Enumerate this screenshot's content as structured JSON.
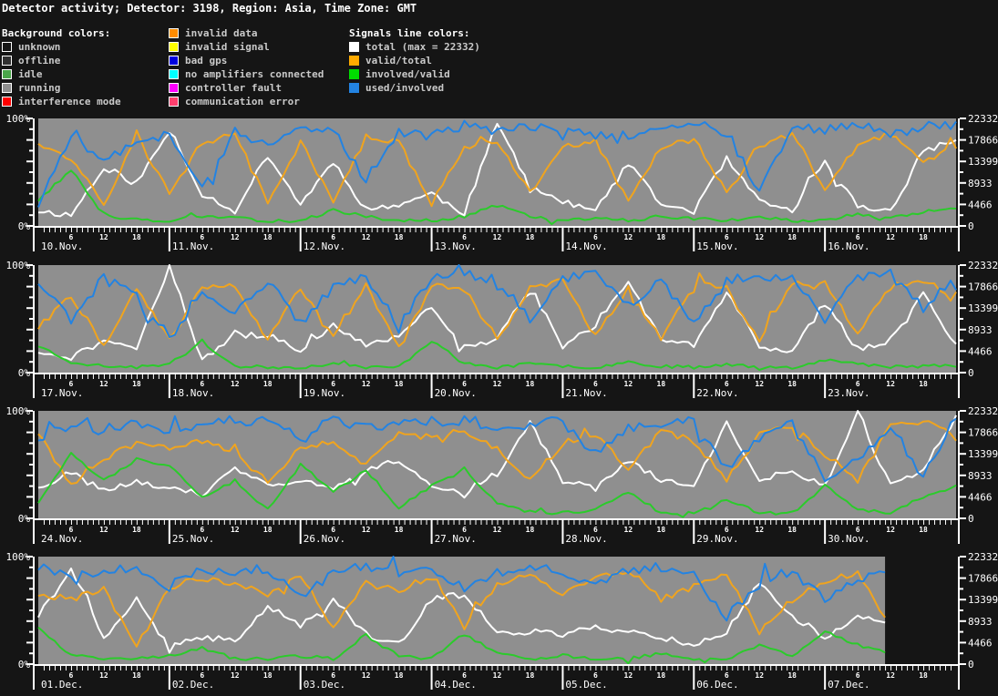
{
  "title": "Detector activity; Detector: 3198, Region: Asia, Time Zone: GMT",
  "colors": {
    "page_bg": "#151515",
    "plot_bg": "#8f8f8f",
    "axis": "#ffffff",
    "legend_text": "#c9c9c9",
    "header_text": "#ffffff"
  },
  "legend": {
    "background_header": "Background colors:",
    "background_items": [
      {
        "label": "unknown",
        "color": "#151515"
      },
      {
        "label": "offline",
        "color": "#303030"
      },
      {
        "label": "idle",
        "color": "#4aa64a"
      },
      {
        "label": "running",
        "color": "#8f8f8f"
      },
      {
        "label": "interference mode",
        "color": "#ff0000"
      }
    ],
    "status_items": [
      {
        "label": "invalid data",
        "color": "#ff8c00"
      },
      {
        "label": "invalid signal",
        "color": "#ffff00"
      },
      {
        "label": "bad gps",
        "color": "#0000dd"
      },
      {
        "label": "no amplifiers connected",
        "color": "#00ffff"
      },
      {
        "label": "controller fault",
        "color": "#ff00ff"
      },
      {
        "label": "communication error",
        "color": "#ff3f6e"
      }
    ],
    "signals_header": "Signals line colors:",
    "signal_items": [
      {
        "label": "total (max = 22332)",
        "color": "#ffffff"
      },
      {
        "label": "valid/total",
        "color": "#ffaa00"
      },
      {
        "label": "involved/valid",
        "color": "#00dd00"
      },
      {
        "label": "used/involved",
        "color": "#2383e2"
      }
    ]
  },
  "axes": {
    "left_top": "100%",
    "left_bottom": "0%",
    "right_labels": [
      "22332",
      "17866",
      "13399",
      "8933",
      "4466",
      "0"
    ],
    "right_max": 22332,
    "hour_labels": [
      "6",
      "12",
      "18"
    ]
  },
  "chart_data": [
    {
      "type": "line",
      "dates": [
        "10.Nov.",
        "11.Nov.",
        "12.Nov.",
        "13.Nov.",
        "14.Nov.",
        "15.Nov.",
        "16.Nov."
      ],
      "days": 7,
      "end_hour": 168,
      "ylim_left": [
        0,
        100
      ],
      "ylim_right": [
        0,
        22332
      ],
      "background_state": "running",
      "series": [
        {
          "name": "total",
          "color": "#ffffff",
          "jitter": 3,
          "seed": 11,
          "values6h": [
            14,
            10,
            55,
            40,
            88,
            30,
            14,
            66,
            20,
            60,
            15,
            20,
            30,
            12,
            95,
            38,
            22,
            14,
            58,
            20,
            14,
            62,
            22,
            14,
            60,
            18,
            14,
            70,
            80
          ]
        },
        {
          "name": "valid/total",
          "color": "#f0a41e",
          "jitter": 3,
          "seed": 12,
          "values6h": [
            78,
            62,
            20,
            82,
            30,
            78,
            85,
            22,
            78,
            22,
            83,
            78,
            20,
            73,
            80,
            30,
            73,
            80,
            22,
            73,
            82,
            30,
            73,
            85,
            32,
            78,
            85,
            60,
            74
          ]
        },
        {
          "name": "involved/valid",
          "color": "#2bcb2b",
          "jitter": 1.5,
          "seed": 13,
          "values6h": [
            24,
            52,
            10,
            6,
            5,
            9,
            7,
            5,
            5,
            14,
            9,
            5,
            5,
            9,
            19,
            9,
            5,
            7,
            5,
            9,
            7,
            5,
            9,
            5,
            5,
            11,
            7,
            13,
            17
          ]
        },
        {
          "name": "used/involved",
          "color": "#2383e2",
          "jitter": 5,
          "seed": 14,
          "values6h": [
            20,
            85,
            62,
            76,
            86,
            35,
            88,
            74,
            94,
            88,
            42,
            88,
            84,
            94,
            88,
            94,
            88,
            84,
            80,
            88,
            94,
            88,
            32,
            93,
            88,
            94,
            84,
            94,
            94
          ]
        }
      ]
    },
    {
      "type": "line",
      "dates": [
        "17.Nov.",
        "18.Nov.",
        "19.Nov.",
        "20.Nov.",
        "21.Nov.",
        "22.Nov.",
        "23.Nov."
      ],
      "days": 7,
      "end_hour": 168,
      "ylim_left": [
        0,
        100
      ],
      "ylim_right": [
        0,
        22332
      ],
      "background_state": "running",
      "series": [
        {
          "name": "total",
          "color": "#ffffff",
          "jitter": 3,
          "seed": 21,
          "values6h": [
            20,
            14,
            30,
            22,
            100,
            12,
            35,
            35,
            20,
            45,
            25,
            35,
            60,
            25,
            30,
            80,
            25,
            45,
            85,
            30,
            25,
            75,
            25,
            20,
            65,
            22,
            30,
            72,
            25
          ]
        },
        {
          "name": "valid/total",
          "color": "#f0a41e",
          "jitter": 3,
          "seed": 22,
          "values6h": [
            42,
            72,
            25,
            78,
            30,
            80,
            82,
            30,
            78,
            35,
            80,
            25,
            80,
            78,
            30,
            80,
            85,
            35,
            80,
            30,
            82,
            78,
            30,
            82,
            85,
            35,
            80,
            85,
            72
          ]
        },
        {
          "name": "involved/valid",
          "color": "#2bcb2b",
          "jitter": 1.5,
          "seed": 23,
          "values6h": [
            25,
            10,
            6,
            5,
            8,
            28,
            6,
            5,
            5,
            8,
            5,
            5,
            30,
            8,
            5,
            8,
            6,
            5,
            10,
            6,
            5,
            8,
            5,
            5,
            12,
            8,
            5,
            8,
            6
          ]
        },
        {
          "name": "used/involved",
          "color": "#2383e2",
          "jitter": 5,
          "seed": 24,
          "values6h": [
            85,
            50,
            88,
            70,
            30,
            78,
            55,
            85,
            45,
            80,
            90,
            45,
            88,
            92,
            85,
            50,
            88,
            92,
            62,
            88,
            45,
            85,
            90,
            88,
            50,
            88,
            92,
            60,
            88
          ]
        }
      ]
    },
    {
      "type": "line",
      "dates": [
        "24.Nov.",
        "25.Nov.",
        "26.Nov.",
        "27.Nov.",
        "28.Nov.",
        "29.Nov.",
        "30.Nov."
      ],
      "days": 7,
      "end_hour": 168,
      "ylim_left": [
        0,
        100
      ],
      "ylim_right": [
        0,
        22332
      ],
      "background_state": "running",
      "series": [
        {
          "name": "total",
          "color": "#ffffff",
          "jitter": 3,
          "seed": 31,
          "values6h": [
            30,
            42,
            25,
            35,
            28,
            22,
            45,
            30,
            35,
            28,
            45,
            55,
            30,
            25,
            42,
            88,
            35,
            28,
            55,
            35,
            30,
            90,
            35,
            45,
            30,
            98,
            30,
            45,
            95
          ]
        },
        {
          "name": "valid/total",
          "color": "#f0a41e",
          "jitter": 3,
          "seed": 32,
          "values6h": [
            80,
            30,
            55,
            70,
            65,
            72,
            60,
            35,
            65,
            72,
            50,
            80,
            75,
            82,
            65,
            35,
            70,
            78,
            45,
            82,
            72,
            35,
            78,
            85,
            60,
            35,
            85,
            90,
            80
          ]
        },
        {
          "name": "involved/valid",
          "color": "#2bcb2b",
          "jitter": 1.5,
          "seed": 33,
          "values6h": [
            15,
            60,
            35,
            55,
            50,
            20,
            35,
            8,
            50,
            25,
            45,
            10,
            30,
            45,
            15,
            5,
            5,
            8,
            25,
            5,
            5,
            18,
            5,
            5,
            30,
            8,
            5,
            20,
            30
          ]
        },
        {
          "name": "used/involved",
          "color": "#2383e2",
          "jitter": 5,
          "seed": 34,
          "values6h": [
            75,
            88,
            82,
            90,
            78,
            85,
            92,
            88,
            75,
            92,
            85,
            88,
            90,
            92,
            85,
            88,
            90,
            60,
            85,
            88,
            92,
            45,
            75,
            88,
            35,
            55,
            85,
            40,
            95
          ]
        }
      ]
    },
    {
      "type": "line",
      "dates": [
        "01.Dec.",
        "02.Dec.",
        "03.Dec.",
        "04.Dec.",
        "05.Dec.",
        "06.Dec.",
        "07.Dec."
      ],
      "days": 7,
      "end_hour": 155,
      "ylim_left": [
        0,
        100
      ],
      "ylim_right": [
        0,
        22332
      ],
      "background_state": "running",
      "series": [
        {
          "name": "total",
          "color": "#ffffff",
          "jitter": 3,
          "seed": 41,
          "values6h": [
            45,
            88,
            25,
            60,
            15,
            25,
            22,
            55,
            35,
            60,
            28,
            18,
            60,
            65,
            30,
            30,
            28,
            35,
            30,
            25,
            18,
            30,
            75,
            45,
            25,
            45,
            35,
            25,
            45
          ]
        },
        {
          "name": "valid/total",
          "color": "#f0a41e",
          "jitter": 3,
          "seed": 42,
          "values6h": [
            65,
            60,
            70,
            15,
            72,
            80,
            75,
            65,
            82,
            35,
            75,
            68,
            80,
            35,
            75,
            82,
            65,
            80,
            88,
            60,
            72,
            85,
            30,
            60,
            78,
            85,
            35,
            85,
            65
          ]
        },
        {
          "name": "involved/valid",
          "color": "#2bcb2b",
          "jitter": 1.5,
          "seed": 43,
          "values6h": [
            35,
            8,
            5,
            5,
            8,
            15,
            5,
            5,
            8,
            5,
            25,
            8,
            5,
            28,
            10,
            5,
            8,
            5,
            5,
            10,
            5,
            5,
            18,
            8,
            30,
            18,
            10,
            25,
            12
          ]
        },
        {
          "name": "used/involved",
          "color": "#2383e2",
          "jitter": 5,
          "seed": 44,
          "values6h": [
            90,
            80,
            85,
            92,
            72,
            88,
            82,
            90,
            60,
            85,
            90,
            82,
            88,
            70,
            85,
            92,
            85,
            72,
            88,
            90,
            82,
            45,
            75,
            88,
            60,
            80,
            88,
            75,
            80
          ]
        }
      ]
    }
  ]
}
